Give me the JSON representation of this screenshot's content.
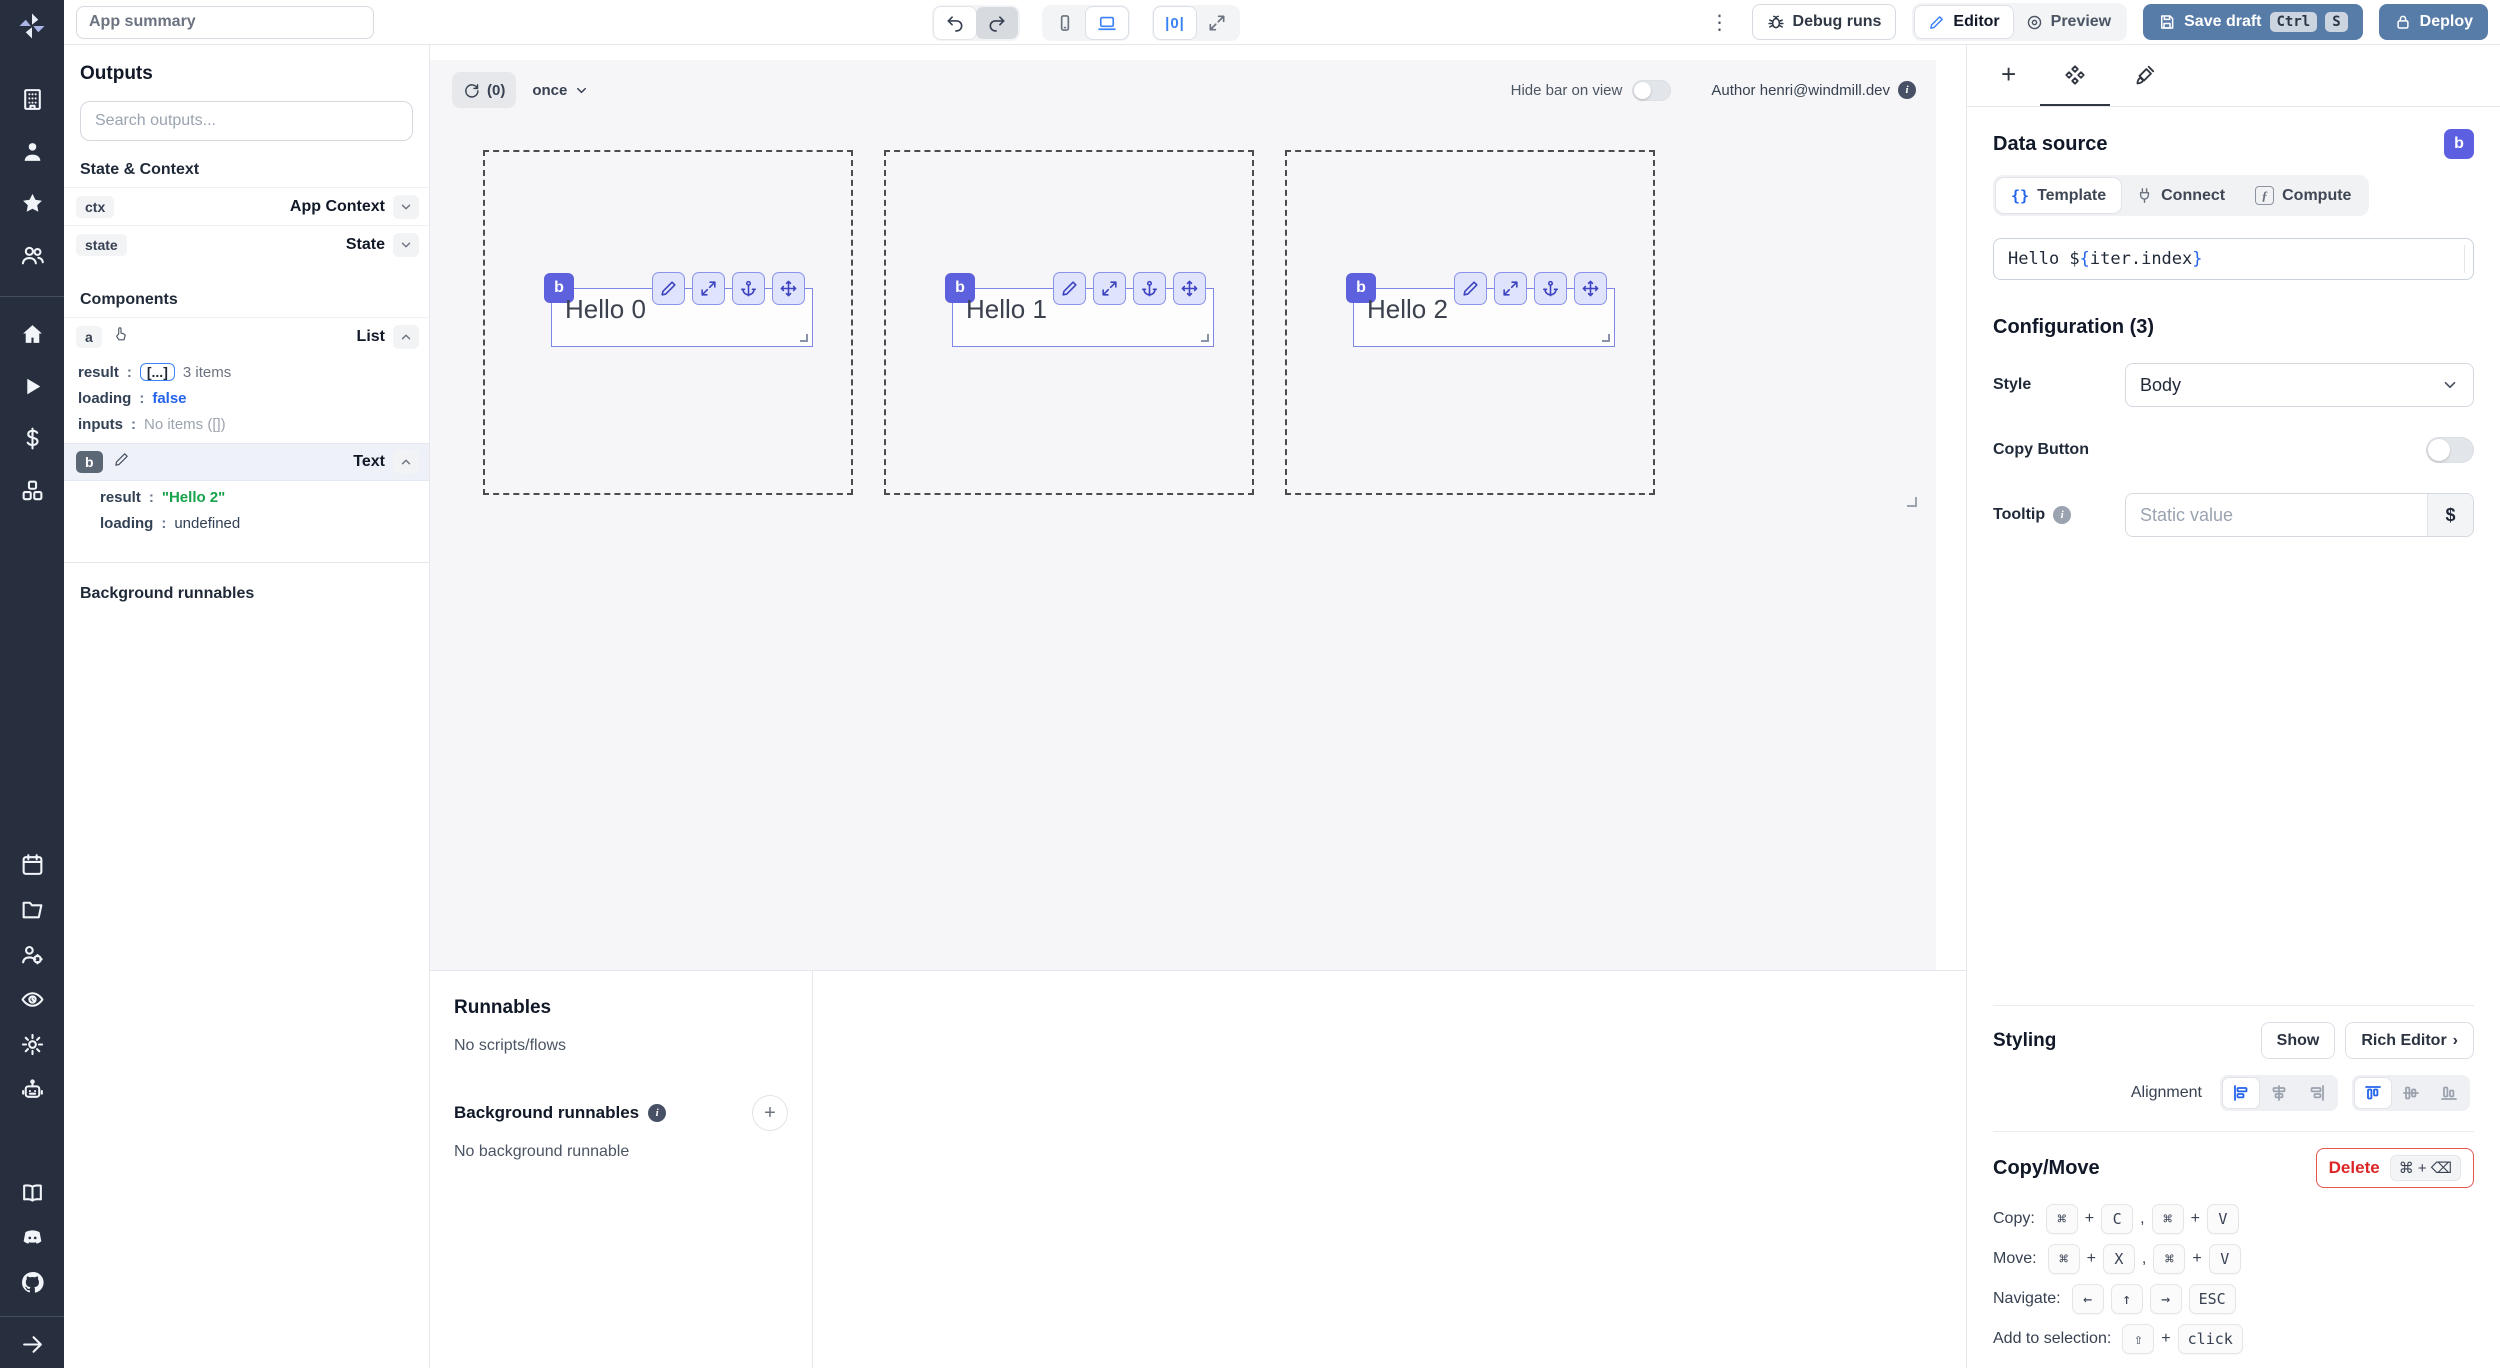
{
  "topbar": {
    "summary_placeholder": "App summary",
    "debug_runs": "Debug runs",
    "editor": "Editor",
    "preview": "Preview",
    "save_draft": "Save draft",
    "kbd_ctrl": "Ctrl",
    "kbd_s": "S",
    "deploy": "Deploy"
  },
  "outputs": {
    "title": "Outputs",
    "search_placeholder": "Search outputs...",
    "state_context_title": "State & Context",
    "components_title": "Components",
    "background_title": "Background runnables",
    "ctx": {
      "key": "ctx",
      "type": "App Context"
    },
    "state": {
      "key": "state",
      "type": "State"
    },
    "a": {
      "id": "a",
      "type": "List",
      "result_key": "result",
      "result_chip": "[...]",
      "result_note": "3 items",
      "loading_key": "loading",
      "loading_val": "false",
      "inputs_key": "inputs",
      "inputs_val": "No items ([])"
    },
    "b": {
      "id": "b",
      "type": "Text",
      "result_key": "result",
      "result_val": "\"Hello 2\"",
      "loading_key": "loading",
      "loading_val": "undefined"
    }
  },
  "canvas": {
    "refresh_count": "(0)",
    "schedule": "once",
    "hide_bar_label": "Hide bar on view",
    "author_label": "Author henri@windmill.dev",
    "items": [
      {
        "badge": "b",
        "text": "Hello 0"
      },
      {
        "badge": "b",
        "text": "Hello 1"
      },
      {
        "badge": "b",
        "text": "Hello 2"
      }
    ]
  },
  "runnables": {
    "title": "Runnables",
    "empty": "No scripts/flows",
    "background_title": "Background runnables",
    "background_empty": "No background runnable"
  },
  "right": {
    "data_source_title": "Data source",
    "badge": "b",
    "tab_template": "Template",
    "tab_connect": "Connect",
    "tab_compute": "Compute",
    "code": {
      "pre": "Hello $",
      "open": "{",
      "expr": "iter.index",
      "close": "}"
    },
    "configuration_title": "Configuration (3)",
    "style_label": "Style",
    "style_value": "Body",
    "copy_button_label": "Copy Button",
    "tooltip_label": "Tooltip",
    "tooltip_placeholder": "Static value",
    "tooltip_suffix": "$",
    "styling": {
      "title": "Styling",
      "show": "Show",
      "rich_editor": "Rich Editor",
      "chevron": "›",
      "alignment_label": "Alignment"
    },
    "copymove": {
      "title": "Copy/Move",
      "delete": "Delete",
      "delete_kbd": "⌘ + ⌫",
      "copy_label": "Copy:",
      "move_label": "Move:",
      "navigate_label": "Navigate:",
      "add_label": "Add to selection:",
      "keys": {
        "cmd": "⌘",
        "c": "C",
        "v": "V",
        "x": "X",
        "left": "←",
        "up": "↑",
        "right": "→",
        "esc": "ESC",
        "shift": "⇧",
        "click": "click"
      }
    }
  },
  "misc": {
    "colon": ":",
    "comma": ",",
    "plus": "+",
    "zero_center": "|0|",
    "braces": "{}",
    "fx": "ƒ",
    "kebab": "⋮"
  }
}
